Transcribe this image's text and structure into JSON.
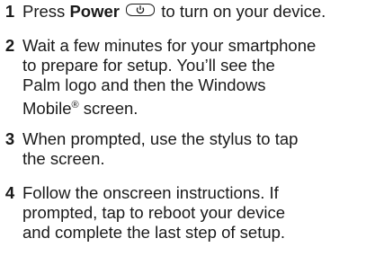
{
  "steps": [
    {
      "number": "1",
      "parts": {
        "pre": "Press ",
        "bold": "Power",
        "post": " to turn on your device."
      },
      "icon": "power-button-icon"
    },
    {
      "number": "2",
      "lines": [
        "Wait a few minutes for your smartphone",
        "to prepare for setup. You’ll see the",
        "Palm logo and then the Windows",
        "Mobile",
        "®",
        " screen."
      ]
    },
    {
      "number": "3",
      "lines": [
        "When prompted, use the stylus to tap",
        "the screen."
      ]
    },
    {
      "number": "4",
      "lines": [
        "Follow the onscreen instructions. If",
        "prompted, tap to reboot your device",
        "and complete the last step of setup."
      ]
    }
  ]
}
